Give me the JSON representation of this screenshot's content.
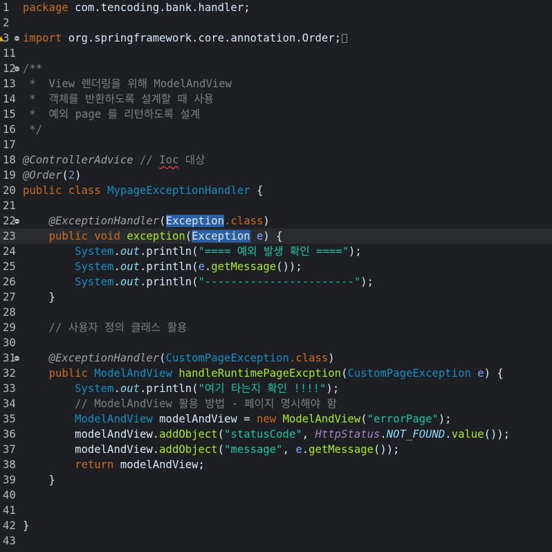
{
  "editor": {
    "lines": [
      {
        "num": "1",
        "tokens": [
          {
            "t": "package",
            "k": "keyword"
          },
          {
            "t": " com.tencoding.bank.handler;",
            "k": "plain"
          }
        ]
      },
      {
        "num": "2",
        "tokens": []
      },
      {
        "num": "3",
        "fold": true,
        "warning": true,
        "tokens": [
          {
            "t": "import",
            "k": "keyword"
          },
          {
            "t": " org.springframework.core.annotation.Order;",
            "k": "plain"
          },
          {
            "t": "",
            "k": "box"
          }
        ]
      },
      {
        "num": "11",
        "tokens": []
      },
      {
        "num": "12",
        "fold": true,
        "tokens": [
          {
            "t": "/**",
            "k": "comment"
          }
        ]
      },
      {
        "num": "13",
        "tokens": [
          {
            "t": " *  View 렌더링을 위해 ModelAndView",
            "k": "comment"
          }
        ]
      },
      {
        "num": "14",
        "tokens": [
          {
            "t": " *  객체를 반환하도록 설계할 때 사용",
            "k": "comment"
          }
        ]
      },
      {
        "num": "15",
        "tokens": [
          {
            "t": " *  예외 page 를 리턴하도록 설계",
            "k": "comment"
          }
        ]
      },
      {
        "num": "16",
        "tokens": [
          {
            "t": " */",
            "k": "comment"
          }
        ]
      },
      {
        "num": "17",
        "tokens": []
      },
      {
        "num": "18",
        "tokens": [
          {
            "t": "@ControllerAdvice",
            "k": "annotation"
          },
          {
            "t": " // ",
            "k": "comment"
          },
          {
            "t": "Ioc",
            "k": "comment-squiggle"
          },
          {
            "t": " 대상",
            "k": "comment"
          }
        ]
      },
      {
        "num": "19",
        "tokens": [
          {
            "t": "@Order",
            "k": "annotation"
          },
          {
            "t": "(",
            "k": "plain"
          },
          {
            "t": "2",
            "k": "number"
          },
          {
            "t": ")",
            "k": "plain"
          }
        ]
      },
      {
        "num": "20",
        "tokens": [
          {
            "t": "public class",
            "k": "keyword"
          },
          {
            "t": " ",
            "k": "plain"
          },
          {
            "t": "MypageExceptionHandler",
            "k": "type"
          },
          {
            "t": " {",
            "k": "plain"
          }
        ]
      },
      {
        "num": "21",
        "tokens": []
      },
      {
        "num": "22",
        "fold": true,
        "tokens": [
          {
            "t": "    ",
            "k": "plain"
          },
          {
            "t": "@ExceptionHandler",
            "k": "annotation"
          },
          {
            "t": "(",
            "k": "plain"
          },
          {
            "t": "Exception",
            "k": "hl"
          },
          {
            "t": ".class",
            "k": "keyword"
          },
          {
            "t": ")",
            "k": "plain"
          }
        ]
      },
      {
        "num": "23",
        "current": true,
        "tokens": [
          {
            "t": "    ",
            "k": "plain"
          },
          {
            "t": "public void",
            "k": "keyword"
          },
          {
            "t": " ",
            "k": "plain"
          },
          {
            "t": "exception",
            "k": "method"
          },
          {
            "t": "(",
            "k": "plain"
          },
          {
            "t": "Exception",
            "k": "hl"
          },
          {
            "t": " ",
            "k": "plain"
          },
          {
            "t": "e",
            "k": "var"
          },
          {
            "t": ") {",
            "k": "plain"
          }
        ]
      },
      {
        "num": "24",
        "tokens": [
          {
            "t": "        ",
            "k": "plain"
          },
          {
            "t": "System",
            "k": "type"
          },
          {
            "t": ".",
            "k": "plain"
          },
          {
            "t": "out",
            "k": "field"
          },
          {
            "t": ".println(",
            "k": "plain"
          },
          {
            "t": "\"==== 예외 발생 확인 ====\"",
            "k": "string"
          },
          {
            "t": ");",
            "k": "plain"
          }
        ]
      },
      {
        "num": "25",
        "tokens": [
          {
            "t": "        ",
            "k": "plain"
          },
          {
            "t": "System",
            "k": "type"
          },
          {
            "t": ".",
            "k": "plain"
          },
          {
            "t": "out",
            "k": "field"
          },
          {
            "t": ".println(",
            "k": "plain"
          },
          {
            "t": "e",
            "k": "var"
          },
          {
            "t": ".",
            "k": "plain"
          },
          {
            "t": "getMessage",
            "k": "method"
          },
          {
            "t": "());",
            "k": "plain"
          }
        ]
      },
      {
        "num": "26",
        "tokens": [
          {
            "t": "        ",
            "k": "plain"
          },
          {
            "t": "System",
            "k": "type"
          },
          {
            "t": ".",
            "k": "plain"
          },
          {
            "t": "out",
            "k": "field"
          },
          {
            "t": ".println(",
            "k": "plain"
          },
          {
            "t": "\"-----------------------\"",
            "k": "string"
          },
          {
            "t": ");",
            "k": "plain"
          }
        ]
      },
      {
        "num": "27",
        "tokens": [
          {
            "t": "    }",
            "k": "plain"
          }
        ]
      },
      {
        "num": "28",
        "tokens": []
      },
      {
        "num": "29",
        "tokens": [
          {
            "t": "    // 사용자 정의 클래스 활용",
            "k": "comment"
          }
        ]
      },
      {
        "num": "30",
        "tokens": []
      },
      {
        "num": "31",
        "fold": true,
        "tokens": [
          {
            "t": "    ",
            "k": "plain"
          },
          {
            "t": "@ExceptionHandler",
            "k": "annotation"
          },
          {
            "t": "(",
            "k": "plain"
          },
          {
            "t": "CustomPageException",
            "k": "type"
          },
          {
            "t": ".class",
            "k": "keyword"
          },
          {
            "t": ")",
            "k": "plain"
          }
        ]
      },
      {
        "num": "32",
        "tokens": [
          {
            "t": "    ",
            "k": "plain"
          },
          {
            "t": "public",
            "k": "keyword"
          },
          {
            "t": " ",
            "k": "plain"
          },
          {
            "t": "ModelAndView",
            "k": "type"
          },
          {
            "t": " ",
            "k": "plain"
          },
          {
            "t": "handleRuntimePageExcption",
            "k": "method"
          },
          {
            "t": "(",
            "k": "plain"
          },
          {
            "t": "CustomPageException",
            "k": "type"
          },
          {
            "t": " ",
            "k": "plain"
          },
          {
            "t": "e",
            "k": "var"
          },
          {
            "t": ") {",
            "k": "plain"
          }
        ]
      },
      {
        "num": "33",
        "tokens": [
          {
            "t": "        ",
            "k": "plain"
          },
          {
            "t": "System",
            "k": "type"
          },
          {
            "t": ".",
            "k": "plain"
          },
          {
            "t": "out",
            "k": "field"
          },
          {
            "t": ".println(",
            "k": "plain"
          },
          {
            "t": "\"여기 타는지 확인 !!!!\"",
            "k": "string"
          },
          {
            "t": ");",
            "k": "plain"
          }
        ]
      },
      {
        "num": "34",
        "tokens": [
          {
            "t": "        // ModelAndView 활용 방법 - 페이지 명시해야 함",
            "k": "comment"
          }
        ]
      },
      {
        "num": "35",
        "tokens": [
          {
            "t": "        ",
            "k": "plain"
          },
          {
            "t": "ModelAndView",
            "k": "type"
          },
          {
            "t": " ",
            "k": "plain"
          },
          {
            "t": "modelAndView",
            "k": "plain"
          },
          {
            "t": " = ",
            "k": "plain"
          },
          {
            "t": "new",
            "k": "keyword"
          },
          {
            "t": " ",
            "k": "plain"
          },
          {
            "t": "ModelAndView",
            "k": "method"
          },
          {
            "t": "(",
            "k": "plain"
          },
          {
            "t": "\"errorPage\"",
            "k": "string"
          },
          {
            "t": ");",
            "k": "plain"
          }
        ]
      },
      {
        "num": "36",
        "tokens": [
          {
            "t": "        ",
            "k": "plain"
          },
          {
            "t": "modelAndView",
            "k": "plain"
          },
          {
            "t": ".",
            "k": "plain"
          },
          {
            "t": "addObject",
            "k": "method"
          },
          {
            "t": "(",
            "k": "plain"
          },
          {
            "t": "\"statusCode\"",
            "k": "string"
          },
          {
            "t": ", ",
            "k": "plain"
          },
          {
            "t": "HttpStatus",
            "k": "static-type"
          },
          {
            "t": ".",
            "k": "plain"
          },
          {
            "t": "NOT_FOUND",
            "k": "const"
          },
          {
            "t": ".",
            "k": "plain"
          },
          {
            "t": "value",
            "k": "method"
          },
          {
            "t": "());",
            "k": "plain"
          }
        ]
      },
      {
        "num": "37",
        "tokens": [
          {
            "t": "        ",
            "k": "plain"
          },
          {
            "t": "modelAndView",
            "k": "plain"
          },
          {
            "t": ".",
            "k": "plain"
          },
          {
            "t": "addObject",
            "k": "method"
          },
          {
            "t": "(",
            "k": "plain"
          },
          {
            "t": "\"message\"",
            "k": "string"
          },
          {
            "t": ", ",
            "k": "plain"
          },
          {
            "t": "e",
            "k": "var"
          },
          {
            "t": ".",
            "k": "plain"
          },
          {
            "t": "getMessage",
            "k": "method"
          },
          {
            "t": "());",
            "k": "plain"
          }
        ]
      },
      {
        "num": "38",
        "tokens": [
          {
            "t": "        ",
            "k": "plain"
          },
          {
            "t": "return",
            "k": "keyword"
          },
          {
            "t": " modelAndView;",
            "k": "plain"
          }
        ]
      },
      {
        "num": "39",
        "tokens": [
          {
            "t": "    }",
            "k": "plain"
          }
        ]
      },
      {
        "num": "40",
        "tokens": []
      },
      {
        "num": "41",
        "tokens": []
      },
      {
        "num": "42",
        "tokens": [
          {
            "t": "}",
            "k": "plain"
          }
        ]
      },
      {
        "num": "43",
        "tokens": []
      }
    ]
  },
  "colors": {
    "background": "#1e1f22",
    "current_line": "#2b2c30",
    "keyword": "#cc6c1d",
    "type": "#1290c3",
    "string": "#17c6a3",
    "method": "#a7ec21",
    "comment": "#808080",
    "selection_highlight": "#2a5fa6"
  },
  "icons": {
    "fold": "fold-minus-icon",
    "warning": "warning-icon"
  }
}
